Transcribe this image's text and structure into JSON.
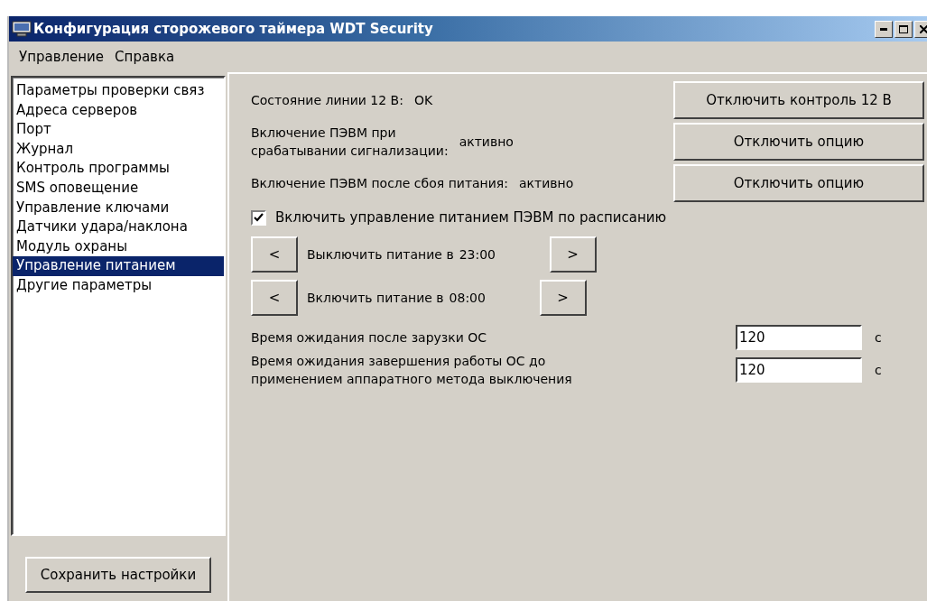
{
  "window": {
    "title": "Конфигурация сторожевого таймера WDT Security"
  },
  "menu": [
    "Управление",
    "Справка"
  ],
  "sidebar": {
    "items": [
      {
        "label": "Параметры проверки связ",
        "selected": false
      },
      {
        "label": "Адреса серверов",
        "selected": false
      },
      {
        "label": "Порт",
        "selected": false
      },
      {
        "label": "Журнал",
        "selected": false
      },
      {
        "label": "Контроль программы",
        "selected": false
      },
      {
        "label": "SMS оповещение",
        "selected": false
      },
      {
        "label": "Управление ключами",
        "selected": false
      },
      {
        "label": "Датчики удара/наклона",
        "selected": false
      },
      {
        "label": "Модуль охраны",
        "selected": false
      },
      {
        "label": "Управление питанием",
        "selected": true
      },
      {
        "label": "Другие параметры",
        "selected": false
      }
    ]
  },
  "save_button": "Сохранить настройки",
  "status_rows": [
    {
      "label": "Состояние линии 12 В:",
      "value": "OK",
      "button": "Отключить контроль 12 В"
    },
    {
      "label": "Включение ПЭВМ при\nсрабатывании сигнализации:",
      "value": "активно",
      "button": "Отключить опцию"
    },
    {
      "label": "Включение ПЭВМ после сбоя питания:",
      "value": "активно",
      "button": "Отключить опцию"
    }
  ],
  "schedule": {
    "label": "Включить управление питанием ПЭВМ по расписанию",
    "checked": true
  },
  "schedule_times": [
    {
      "prev": "<",
      "label": "Выключить питание в",
      "time": "23:00",
      "next": ">"
    },
    {
      "prev": "<",
      "label": "Включить питание в",
      "time": "08:00",
      "next": ">"
    }
  ],
  "timeouts": [
    {
      "label": "Время ожидания после зарузки ОС",
      "value": "120",
      "unit": "с"
    },
    {
      "label": "Время ожидания завершения работы ОС до\nприменением аппаратного метода выключения",
      "value": "120",
      "unit": "с"
    }
  ]
}
